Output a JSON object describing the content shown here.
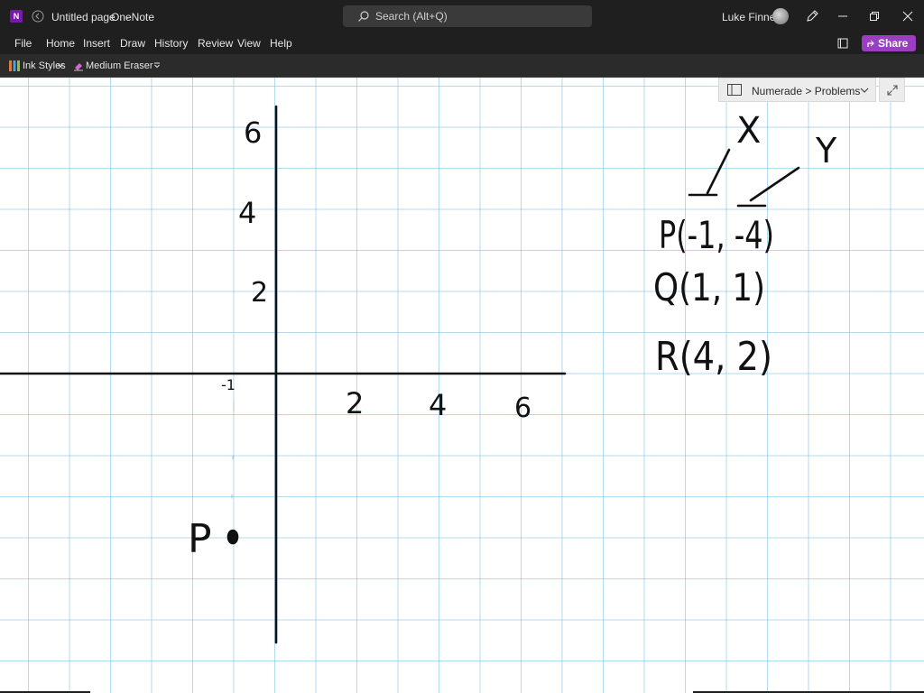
{
  "titlebar": {
    "page_title": "Untitled page",
    "separator": "-",
    "app_name": "OneNote",
    "app_icon_letter": "N",
    "search_placeholder": "Search (Alt+Q)",
    "user_name": "Luke Finney"
  },
  "menu": {
    "items": [
      "File",
      "Home",
      "Insert",
      "Draw",
      "History",
      "Review",
      "View",
      "Help"
    ],
    "share_label": "Share"
  },
  "ribbon": {
    "ink_styles": "Ink Styles",
    "eraser": "Medium Eraser"
  },
  "notebook": {
    "breadcrumb": "Numerade > Problems"
  },
  "handwriting": {
    "y_ticks": [
      "6",
      "4",
      "2"
    ],
    "x_ticks": [
      "2",
      "4",
      "6"
    ],
    "neg_tick": "-1",
    "point_label": "P",
    "axis_note_x": "X",
    "axis_note_y": "Y",
    "points": [
      "P(-1, -4)",
      "Q(1, 1)",
      "R(4, 2)"
    ]
  },
  "colors": {
    "titlebar": "#1f1f1f",
    "accent_share": "#9b3ec1",
    "onenote_purple": "#7719aa",
    "grid": "#76bcde",
    "ink": "#111111"
  }
}
